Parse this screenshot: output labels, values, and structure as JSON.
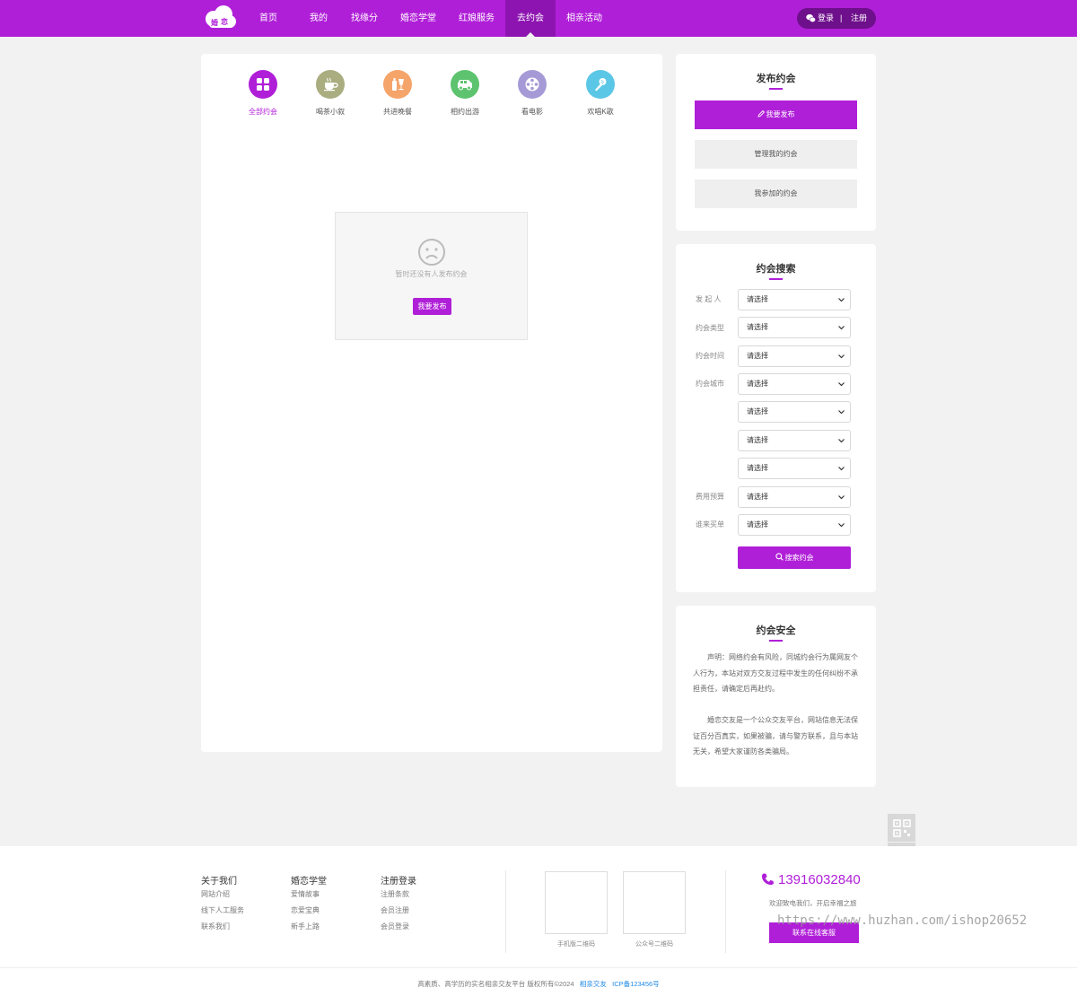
{
  "header": {
    "logo_text": "婚恋",
    "nav": [
      "首页",
      "我的",
      "找缘分",
      "婚恋学堂",
      "红娘服务",
      "去约会",
      "相亲活动"
    ],
    "active_index": 5,
    "login": "登录",
    "separator": "|",
    "register": "注册"
  },
  "categories": [
    {
      "label": "全部约会",
      "icon": "grid-icon",
      "color": "#b01fd8"
    },
    {
      "label": "喝茶小叙",
      "icon": "tea-cup-icon",
      "color": "#a9ad7f"
    },
    {
      "label": "共进晚餐",
      "icon": "dinner-icon",
      "color": "#f5a46a"
    },
    {
      "label": "相约出游",
      "icon": "car-icon",
      "color": "#5dc36e"
    },
    {
      "label": "看电影",
      "icon": "film-reel-icon",
      "color": "#a59ad6"
    },
    {
      "label": "欢唱K歌",
      "icon": "microphone-icon",
      "color": "#5bc7e6"
    }
  ],
  "empty": {
    "text": "暂时还没有人发布约会",
    "button": "我要发布"
  },
  "publish": {
    "title": "发布约会",
    "primary": "我要发布",
    "manage": "管理我的约会",
    "joined": "我参加的约会"
  },
  "search": {
    "title": "约会搜索",
    "labels": [
      "发 起 人",
      "约会类型",
      "约会时间",
      "约会城市",
      "",
      "",
      "",
      "费用预算",
      "谁来买单"
    ],
    "placeholder": "请选择",
    "button": "搜索约会"
  },
  "safety": {
    "title": "约会安全",
    "p1": "声明：网络约会有风险，同城约会行为属网友个人行为，本站对双方交友过程中发生的任何纠纷不承担责任，请确定后再赴约。",
    "p2": "婚恋交友是一个公众交友平台，网站信息无法保证百分百真实，如果被骗，请与警方联系，且与本站无关，希望大家谨防各类骗局。"
  },
  "footer": {
    "col1": {
      "title": "关于我们",
      "links": [
        "网站介绍",
        "线下人工服务",
        "联系我们"
      ]
    },
    "col2": {
      "title": "婚恋学堂",
      "links": [
        "爱情故事",
        "恋爱宝典",
        "新手上路"
      ]
    },
    "col3": {
      "title": "注册登录",
      "links": [
        "注册条款",
        "会员注册",
        "会员登录"
      ]
    },
    "qr1": "手机版二维码",
    "qr2": "公众号二维码",
    "phone": "13916032840",
    "welcome": "欢迎致电我们，开启幸福之旅",
    "service_button": "联系在线客服",
    "watermark": "https://www.huzhan.com/ishop20652",
    "copyright_main": "高素质、高学历的实名相亲交友平台   版权所有©2024",
    "copyright_link": "相亲交友",
    "icp": "ICP备123456号"
  }
}
